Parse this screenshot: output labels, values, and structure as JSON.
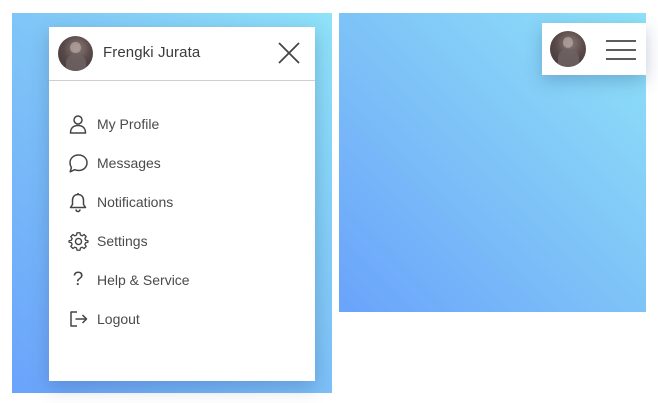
{
  "user": {
    "name": "Frengki Jurata"
  },
  "menu": {
    "items": [
      {
        "label": "My Profile",
        "icon": "user-icon"
      },
      {
        "label": "Messages",
        "icon": "chat-bubble-icon"
      },
      {
        "label": "Notifications",
        "icon": "bell-icon"
      },
      {
        "label": "Settings",
        "icon": "gear-icon"
      },
      {
        "label": "Help & Service",
        "icon": "question-mark-icon",
        "glyph": "?"
      },
      {
        "label": "Logout",
        "icon": "logout-icon"
      }
    ]
  },
  "colors": {
    "gradient_start": "#6aa3fb",
    "gradient_end": "#8fe2f9",
    "text": "#4a4a4a"
  }
}
